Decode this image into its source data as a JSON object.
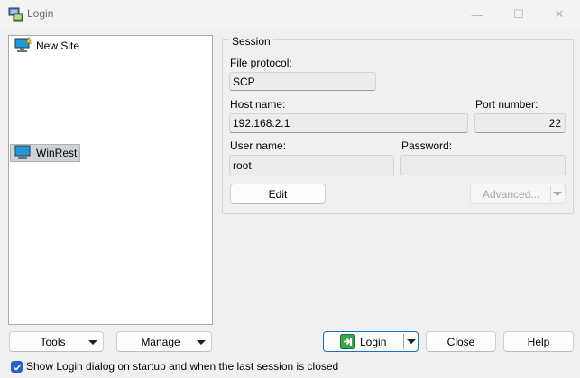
{
  "window": {
    "title": "Login",
    "controls": {
      "minimize": "—",
      "maximize": "☐",
      "close": "✕"
    }
  },
  "site_tree": {
    "items": [
      {
        "label": "New Site",
        "icon": "new-site-icon",
        "selected": false
      },
      {
        "label": "WinRest",
        "icon": "computer-icon",
        "selected": true
      }
    ]
  },
  "session": {
    "group_label": "Session",
    "file_protocol_label": "File protocol:",
    "file_protocol_value": "SCP",
    "host_name_label": "Host name:",
    "host_name_value": "192.168.2.1",
    "port_number_label": "Port number:",
    "port_number_value": "22",
    "user_name_label": "User name:",
    "user_name_value": "root",
    "password_label": "Password:",
    "password_value": "",
    "edit_label": "Edit",
    "advanced_label": "Advanced..."
  },
  "buttons": {
    "tools": "Tools",
    "manage": "Manage",
    "login": "Login",
    "close": "Close",
    "help": "Help"
  },
  "startup_option": {
    "label": "Show Login dialog on startup and when the last session is closed",
    "checked": true
  },
  "colors": {
    "accent": "#2563c7",
    "login_icon": "#3aa64a",
    "computer_screen": "#1f9ad6"
  }
}
